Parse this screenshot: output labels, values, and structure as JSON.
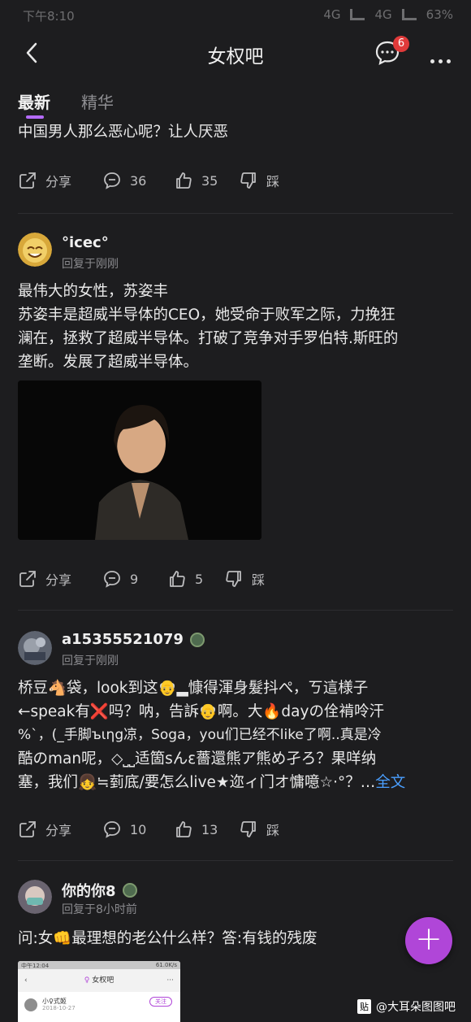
{
  "status_bar": {
    "time": "下午8:10",
    "network1": "4G",
    "network2": "4G",
    "battery": "63%"
  },
  "header": {
    "title": "女权吧",
    "message_badge": "6"
  },
  "tabs": [
    {
      "label": "最新"
    },
    {
      "label": "精华"
    }
  ],
  "posts": [
    {
      "text": "中国男人那么恶心呢？让人厌恶",
      "share_label": "分享",
      "comments": "36",
      "likes": "35",
      "dislike_label": "踩"
    },
    {
      "username": "°icec°",
      "meta": "回复于刚刚",
      "text_lines": [
        "最伟大的女性，苏姿丰",
        "苏姿丰是超威半导体的CEO，她受命于败军之际，力挽狂",
        "澜在，拯救了超威半导体。打破了竞争对手罗伯特.斯旺的",
        "垄断。发展了超威半导体。"
      ],
      "share_label": "分享",
      "comments": "9",
      "likes": "5",
      "dislike_label": "踩"
    },
    {
      "username": "a15355521079",
      "meta": "回复于刚刚",
      "text_lines": [
        "桥豆🐴袋，look到这👴▂慷得渾身髮抖ぺ，ㄎ這様子",
        "←speak有❌吗？呐，告訴👴啊。大🔥dayの佺褃呤汗",
        "%`，(_手脚ъιηg凉，Soga，you们已经不like了啊..真是冷",
        "酷のman呢，◇⎵⎵适箇sんε薔還熊ア熊め孑ろ？果咩纳",
        "塞，我们👧≒菿底/要怎么live★迩ィ门オ慵噫☆·°？…"
      ],
      "more_label": "全文",
      "share_label": "分享",
      "comments": "10",
      "likes": "13",
      "dislike_label": "踩"
    },
    {
      "username": "你的你8",
      "meta": "回复于8小时前",
      "text": "问:女👊最理想的老公什么样？答:有钱的残废",
      "thumb": {
        "time": "中午12:04",
        "speed": "61.0K/s",
        "title": "女权吧",
        "user": "小♀式姬",
        "date": "2018-10-27",
        "follow": "关注"
      }
    }
  ],
  "watermark": {
    "logo": "贴",
    "text": "@大耳朵图图吧"
  },
  "colors": {
    "accent": "#b56bff",
    "fab": "#b046d8",
    "badge": "#e03a3a",
    "link": "#4a9fff"
  }
}
